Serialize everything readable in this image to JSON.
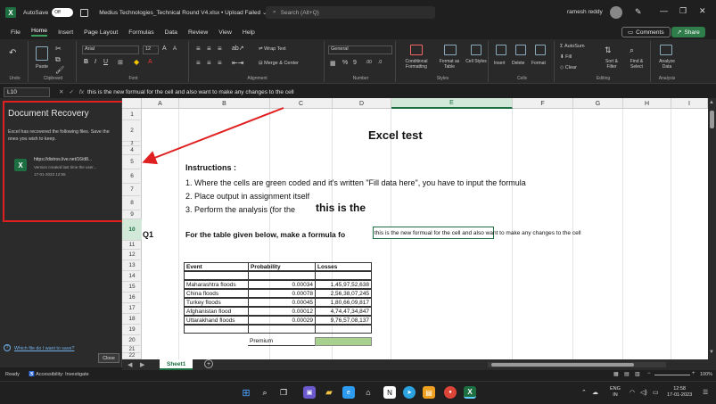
{
  "titlebar": {
    "autosave_label": "AutoSave",
    "autosave_state": "Off",
    "doc_title": "Medius Technologies_Technical Round V4.xlsx • Upload Failed ⌄",
    "search_placeholder": "Search (Alt+Q)",
    "user_name": "ramesh reddy"
  },
  "menu": {
    "items": [
      "File",
      "Home",
      "Insert",
      "Page Layout",
      "Formulas",
      "Data",
      "Review",
      "View",
      "Help"
    ],
    "active": "Home",
    "comments_label": "Comments",
    "share_label": "Share"
  },
  "ribbon": {
    "undo_label": "Undo",
    "clipboard_label": "Clipboard",
    "paste_label": "Paste",
    "font_group_label": "Font",
    "font_name": "Arial",
    "font_size": "12",
    "alignment_label": "Alignment",
    "wrap_text_label": "Wrap Text",
    "merge_center_label": "Merge & Center",
    "number_label": "Number",
    "number_format": "General",
    "styles_label": "Styles",
    "conditional_formatting_label": "Conditional Formatting",
    "format_as_table_label": "Format as Table",
    "cell_styles_label": "Cell Styles",
    "cells_label": "Cells",
    "insert_label": "Insert",
    "delete_label": "Delete",
    "format_label": "Format",
    "editing_label": "Editing",
    "autosum_label": "AutoSum",
    "fill_label": "Fill",
    "clear_label": "Clear",
    "sort_filter_label": "Sort & Filter",
    "find_select_label": "Find & Select",
    "analysis_label": "Analysis",
    "analyze_data_label": "Analyze Data"
  },
  "formula_bar": {
    "name_box": "L10",
    "fx": "fx",
    "content": "this is the new formual for the cell and also want to make any changes to the cell"
  },
  "recovery": {
    "title": "Document Recovery",
    "description": "Excel has recovered the following files. Save the ones you wish to keep.",
    "file_name": "https://distros.live.net/16/d8...",
    "file_note": "Version created last time the user...",
    "file_date": "17-01-2023 12:55",
    "help_link": "Which file do I want to save?",
    "close_label": "Close"
  },
  "grid": {
    "columns": [
      "A",
      "B",
      "C",
      "D",
      "E",
      "F",
      "G",
      "H",
      "I"
    ],
    "selected_column": "E",
    "rows": [
      "1",
      "2",
      "3",
      "4",
      "5",
      "6",
      "7",
      "8",
      "9",
      "10",
      "11",
      "12",
      "13",
      "14",
      "15",
      "16",
      "17",
      "18",
      "19",
      "20",
      "21",
      "22"
    ],
    "selected_row": "10",
    "title": "Excel test",
    "instructions_heading": "Instructions :",
    "instruction_1": "1. Where the cells are green coded and it's written \"Fill data here\", you have to input the formula",
    "instruction_2": "2. Place output in assignment itself",
    "instruction_3": "3. Perform the analysis (for the",
    "overlay_big_text": "this is the",
    "q1_label": "Q1",
    "q1_text": "For the table given below, make a formula fo",
    "editing_cell_text": "this is the new formual for the cell and also want to make any changes to the cell",
    "table": {
      "headers": [
        "Event",
        "Probability",
        "Losses"
      ],
      "rows": [
        [
          "",
          "",
          ""
        ],
        [
          "Maharashtra floods",
          "0.00034",
          "1,45,97,52,638"
        ],
        [
          "China floods",
          "0.00078",
          "2,56,38,07,245"
        ],
        [
          "Turkey floods",
          "0.00045",
          "1,80,66,09,817"
        ],
        [
          "Afghanistan flood",
          "0.00012",
          "4,74,47,34,847"
        ],
        [
          "Uttarakhand floods",
          "0.00029",
          "9,76,57,08,137"
        ],
        [
          "",
          "",
          ""
        ]
      ],
      "premium_label": "Premium"
    }
  },
  "sheet_tabs": {
    "active": "Sheet1"
  },
  "status": {
    "ready": "Ready",
    "accessibility": "Accessibility: Investigate",
    "zoom": "100%"
  },
  "taskbar": {
    "lang_line1": "ENG",
    "lang_line2": "IN",
    "time": "12:58",
    "date": "17-01-2023"
  }
}
